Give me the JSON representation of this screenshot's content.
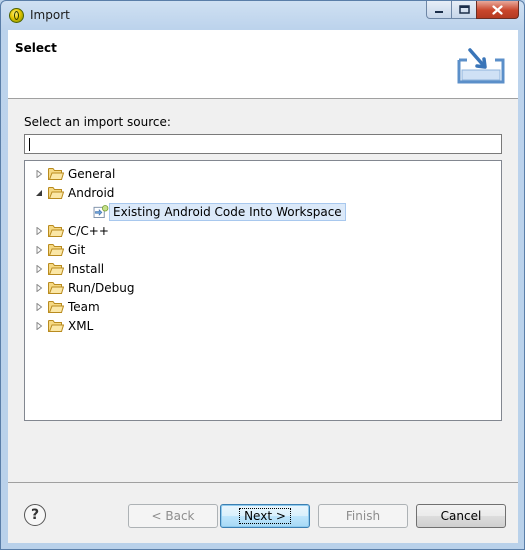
{
  "window": {
    "title": "Import"
  },
  "banner": {
    "title": "Select",
    "icon": "import-wizard-icon"
  },
  "body": {
    "source_label": "Select an import source:",
    "filter_value": ""
  },
  "tree": {
    "items": [
      {
        "label": "General",
        "icon": "folder-icon",
        "expanded": false,
        "level": 0
      },
      {
        "label": "Android",
        "icon": "folder-icon",
        "expanded": true,
        "level": 0
      },
      {
        "label": "Existing Android Code Into Workspace",
        "icon": "android-project-icon",
        "level": 1,
        "selected": true
      },
      {
        "label": "C/C++",
        "icon": "folder-icon",
        "expanded": false,
        "level": 0
      },
      {
        "label": "Git",
        "icon": "folder-icon",
        "expanded": false,
        "level": 0
      },
      {
        "label": "Install",
        "icon": "folder-icon",
        "expanded": false,
        "level": 0
      },
      {
        "label": "Run/Debug",
        "icon": "folder-icon",
        "expanded": false,
        "level": 0
      },
      {
        "label": "Team",
        "icon": "folder-icon",
        "expanded": false,
        "level": 0
      },
      {
        "label": "XML",
        "icon": "folder-icon",
        "expanded": false,
        "level": 0
      }
    ]
  },
  "footer": {
    "help_icon": "?",
    "back_label": "< Back",
    "next_label": "Next >",
    "finish_label": "Finish",
    "cancel_label": "Cancel"
  },
  "colors": {
    "selection_bg": "#dbe9f9",
    "folder": "#e8c25a",
    "frame": "#b9d1ea"
  }
}
